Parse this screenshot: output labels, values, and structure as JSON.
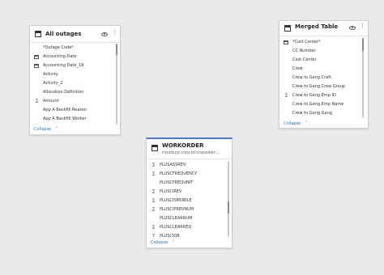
{
  "cards": {
    "all_outages": {
      "title": "All outages",
      "collapse_label": "Collapse",
      "fields": [
        {
          "label": "*Outage Code*",
          "icon": "none"
        },
        {
          "label": "Accounting Date",
          "icon": "calendar-icon"
        },
        {
          "label": "Accounting Date_19",
          "icon": "calendar-icon"
        },
        {
          "label": "Activity",
          "icon": "none"
        },
        {
          "label": "Activity_2",
          "icon": "none"
        },
        {
          "label": "Allocation Definition",
          "icon": "none"
        },
        {
          "label": "Amount",
          "icon": "sigma-icon"
        },
        {
          "label": "App A Backfill Reason",
          "icon": "none"
        },
        {
          "label": "App A Backfill Worker",
          "icon": "none"
        }
      ]
    },
    "merged_table": {
      "title": "Merged Table",
      "collapse_label": "Collapse",
      "fields": [
        {
          "label": "*Cost Center*",
          "icon": "table-icon"
        },
        {
          "label": "CC Number",
          "icon": "none"
        },
        {
          "label": "Cost Center",
          "icon": "none"
        },
        {
          "label": "Crew",
          "icon": "none"
        },
        {
          "label": "Crew to Gang.Craft",
          "icon": "none"
        },
        {
          "label": "Crew to Gang.Crew Group",
          "icon": "none"
        },
        {
          "label": "Crew to Gang.Emp ID",
          "icon": "sigma-icon"
        },
        {
          "label": "Crew to Gang.Emp Name",
          "icon": "none"
        },
        {
          "label": "Crew to Gang.Gang",
          "icon": "none"
        }
      ]
    },
    "workorder": {
      "title": "WORKORDER",
      "subtitle": "mxstbyp.corp.brucepower....",
      "collapse_label": "Collapse",
      "fields": [
        {
          "label": "PLUSASSREV",
          "icon": "sigma-icon"
        },
        {
          "label": "PLUSCFREQUENCY",
          "icon": "sigma-icon"
        },
        {
          "label": "PLUSCFREQUNIT",
          "icon": "none"
        },
        {
          "label": "PLUSCIREV",
          "icon": "sigma-icon"
        },
        {
          "label": "PLUSCISMOBILE",
          "icon": "sigma-icon"
        },
        {
          "label": "PLUSCIPREVNUM",
          "icon": "sigma-icon"
        },
        {
          "label": "PLUSCLEARNUM",
          "icon": "none"
        },
        {
          "label": "PLUSCLEARREQ",
          "icon": "sigma-icon"
        },
        {
          "label": "PLUSCJOB",
          "icon": "sigma-icon"
        }
      ]
    }
  },
  "colors": {
    "canvas": "#eaeaea",
    "selected_border": "#4f79c6",
    "link": "#2c6fb7"
  }
}
